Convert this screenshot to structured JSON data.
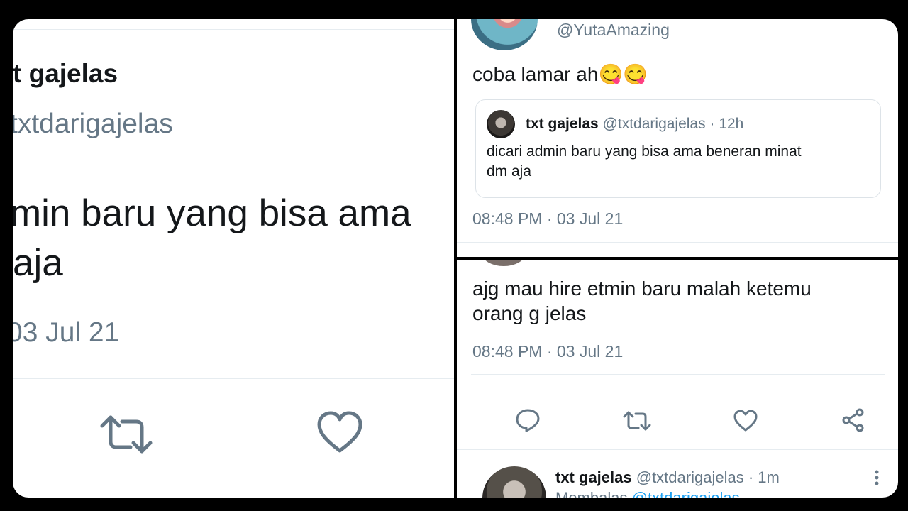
{
  "left_panel": {
    "display_name": "t gajelas",
    "handle": "txtdarigajelas",
    "tweet_line1": "min baru yang bisa ama",
    "tweet_line2": " aja",
    "timestamp": "03 Jul 21",
    "actions": [
      "retweet-icon",
      "like-icon"
    ]
  },
  "right_top": {
    "handle": "@YutaAmazing",
    "reply_text": "coba lamar ah",
    "reply_emojis": "😋😋",
    "quoted_tweet": {
      "display_name": "txt gajelas",
      "handle": "@txtdarigajelas",
      "separator": "·",
      "time": "12h",
      "text_line1": "dicari admin baru yang bisa ama beneran minat",
      "text_line2": "dm aja"
    },
    "timestamp": "08:48 PM · 03 Jul 21"
  },
  "right_bottom": {
    "tweet_line1": "ajg mau hire etmin baru malah ketemu",
    "tweet_line2": "orang g jelas",
    "timestamp": "08:48 PM · 03 Jul 21",
    "actions": [
      "reply-icon",
      "retweet-icon",
      "like-icon",
      "share-icon"
    ],
    "reply": {
      "display_name": "txt gajelas",
      "handle": "@txtdarigajelas",
      "separator": "·",
      "time": "1m",
      "replying_label": "Membalas",
      "replying_to": "@txtdarigajelas"
    }
  },
  "colors": {
    "text": "#14171a",
    "secondary": "#657786",
    "link": "#1da1f2",
    "divider": "#e6ecf0",
    "background": "#000000"
  }
}
